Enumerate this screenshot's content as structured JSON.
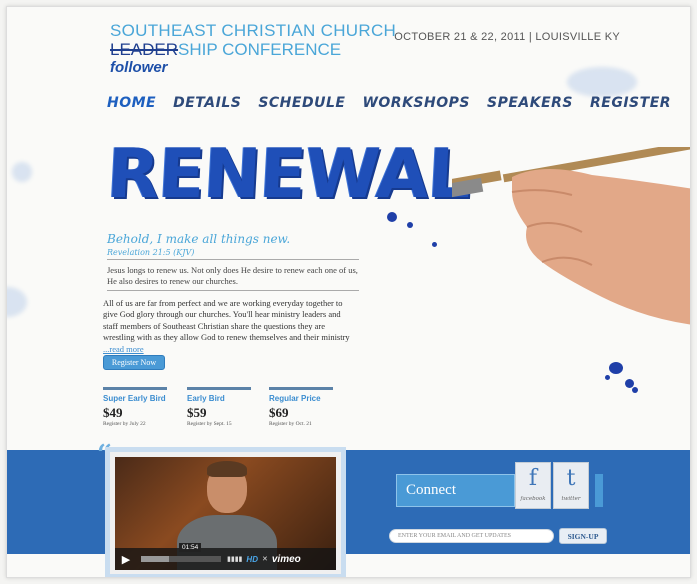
{
  "header": {
    "church_name": "SOUTHEAST CHRISTIAN CHURCH",
    "strike_word": "LEADER",
    "conference_rest": "SHIP CONFERENCE",
    "handwritten": "follower",
    "date_location": "OCTOBER 21 & 22, 2011 | LOUISVILLE KY"
  },
  "nav": {
    "items": [
      {
        "label": "HOME"
      },
      {
        "label": "DETAILS"
      },
      {
        "label": "SCHEDULE"
      },
      {
        "label": "WORKSHOPS"
      },
      {
        "label": "SPEAKERS"
      },
      {
        "label": "REGISTER"
      }
    ]
  },
  "hero": {
    "title": "RENEWAL",
    "verse": "Behold, I make all things new.",
    "verse_ref": "Revelation 21:5 (KJV)",
    "intro": "Jesus longs to renew us. Not only does He desire to renew each one of us, He also desires to renew our churches.",
    "body": "All of us are far from perfect and we are working everyday together to give God glory through our churches. You'll hear ministry leaders and staff members of Southeast Christian share the questions they are wrestling with as they allow God to renew themselves and their ministry ",
    "read_more": "...read more",
    "register_button": "Register Now"
  },
  "pricing": [
    {
      "label": "Super Early Bird",
      "amount": "$49",
      "note": "Register by July 22"
    },
    {
      "label": "Early Bird",
      "amount": "$59",
      "note": "Register by Sept. 15"
    },
    {
      "label": "Regular Price",
      "amount": "$69",
      "note": "Register by Oct. 21"
    }
  ],
  "video": {
    "time": "01:54",
    "hd_label": "HD",
    "brand": "vimeo",
    "progress": 0.35
  },
  "connect": {
    "title": "Connect",
    "facebook_glyph": "f",
    "facebook_caption": "facebook",
    "twitter_glyph": "t",
    "twitter_caption": "twitter",
    "email_placeholder": "ENTER YOUR EMAIL AND GET UPDATES",
    "signup_button": "SIGN-UP"
  },
  "colors": {
    "accent": "#4aa6d8",
    "brand_blue": "#1f4fb8",
    "band": "#2d6bb6"
  }
}
